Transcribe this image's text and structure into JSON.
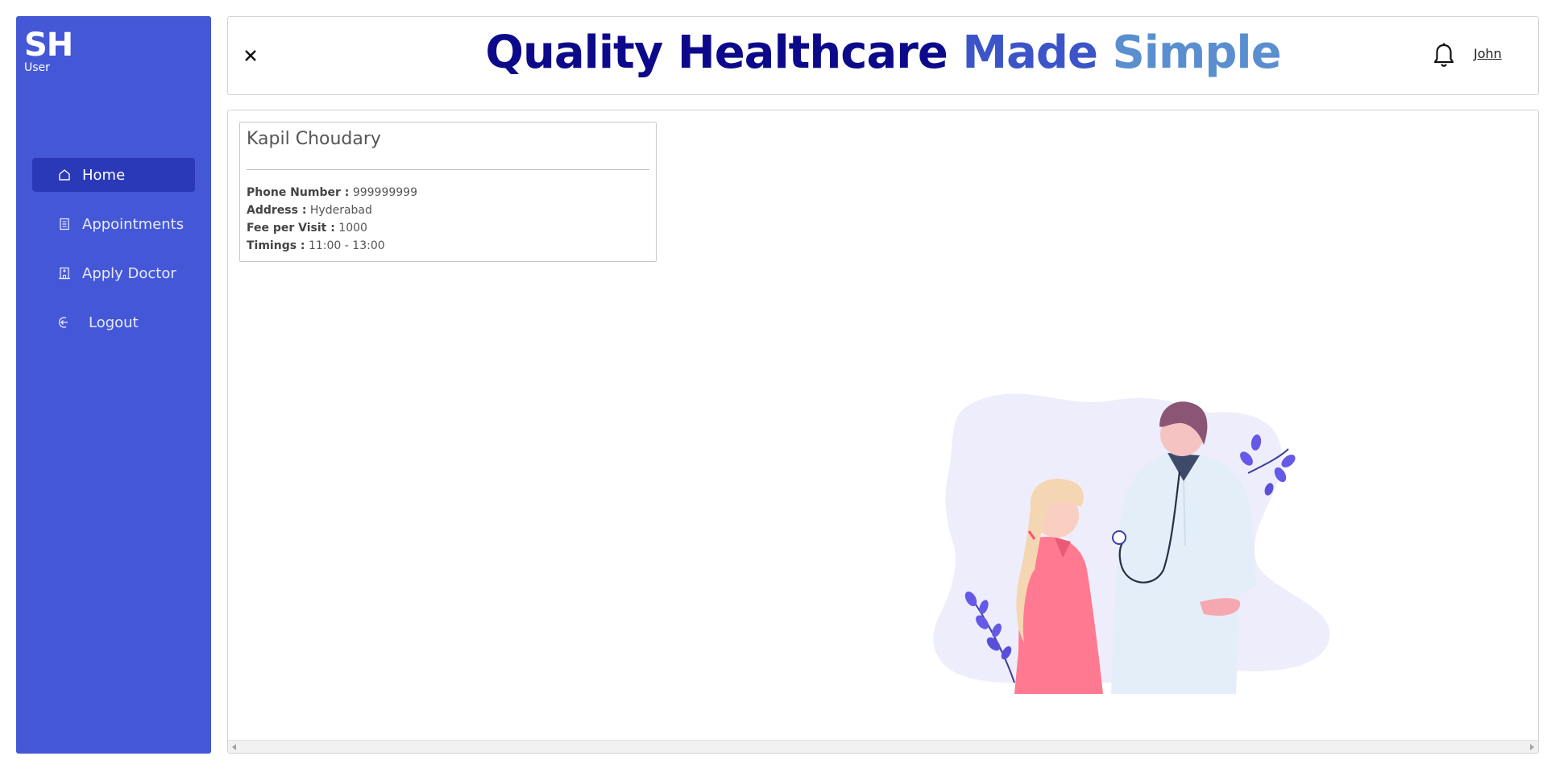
{
  "brand": {
    "title": "SH",
    "role": "User"
  },
  "sidebar": {
    "items": [
      {
        "label": "Home",
        "icon": "home-icon",
        "active": true
      },
      {
        "label": "Appointments",
        "icon": "list-icon",
        "active": false
      },
      {
        "label": "Apply Doctor",
        "icon": "hospital-icon",
        "active": false
      },
      {
        "label": "Logout",
        "icon": "logout-icon",
        "active": false
      }
    ]
  },
  "header": {
    "title_part1": "Quality Healthcare ",
    "title_part2": "Made ",
    "title_part3": "Simple",
    "user_name": "John"
  },
  "doctor_card": {
    "name": "Kapil Choudary",
    "phone_label": "Phone Number :",
    "phone": "999999999",
    "address_label": "Address :",
    "address": "Hyderabad",
    "fee_label": "Fee per Visit :",
    "fee": "1000",
    "timings_label": "Timings :",
    "timings": "11:00 - 13:00"
  },
  "colors": {
    "sidebar_bg": "#4458d7",
    "active_item": "#2a39b8",
    "title_dark": "#0c0a8a",
    "title_mid": "#3b55c9",
    "title_light": "#5a8fcf"
  }
}
